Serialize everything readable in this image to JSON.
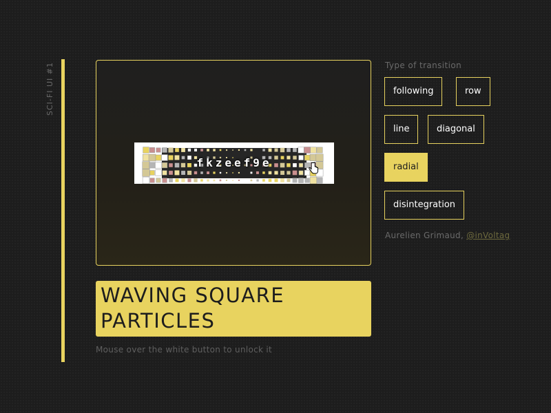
{
  "side_label": "SCI-FI UI #1",
  "preview": {
    "button_text": "fkzeef9e",
    "particle_colors": [
      "#e8d35f",
      "#f0e2a0",
      "#d4c896",
      "#c98f8f",
      "#b5b5b5",
      "#ffffff"
    ]
  },
  "title": {
    "line1": "WAVING SQUARE",
    "line2": "PARTICLES"
  },
  "hint": "Mouse over the white button to unlock it",
  "options": {
    "title": "Type of transition",
    "buttons": [
      {
        "label": "following",
        "active": false
      },
      {
        "label": "row",
        "active": false
      },
      {
        "label": "line",
        "active": false
      },
      {
        "label": "diagonal",
        "active": false
      },
      {
        "label": "radial",
        "active": true
      },
      {
        "label": "disintegration",
        "active": false
      }
    ]
  },
  "credit": {
    "text": "Aurelien Grimaud, ",
    "link": "@inVoltag"
  },
  "colors": {
    "accent": "#e8d35f",
    "background": "#1d1d1d",
    "muted_text": "#6a6a6a"
  }
}
